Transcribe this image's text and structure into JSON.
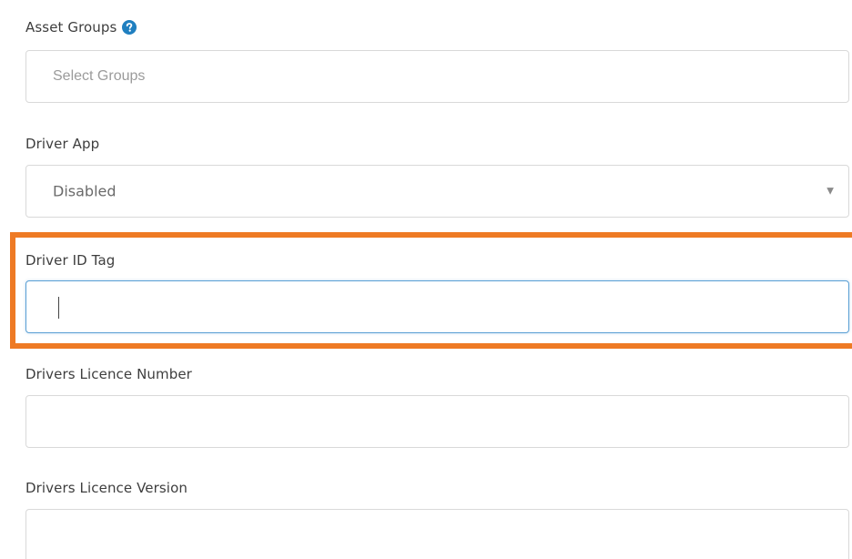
{
  "asset_groups": {
    "label": "Asset Groups",
    "help_icon": "question-circle-icon",
    "placeholder": "Select Groups"
  },
  "driver_app": {
    "label": "Driver App",
    "value": "Disabled",
    "dropdown_icon": "triangle-down-icon"
  },
  "driver_id_tag": {
    "label": "Driver ID Tag",
    "value": ""
  },
  "drivers_licence_number": {
    "label": "Drivers Licence Number",
    "value": ""
  },
  "drivers_licence_version": {
    "label": "Drivers Licence Version",
    "value": ""
  },
  "colors": {
    "highlight": "#ee7a24",
    "help_icon": "#1f7fc0",
    "focus_border": "#5a9fd4"
  }
}
